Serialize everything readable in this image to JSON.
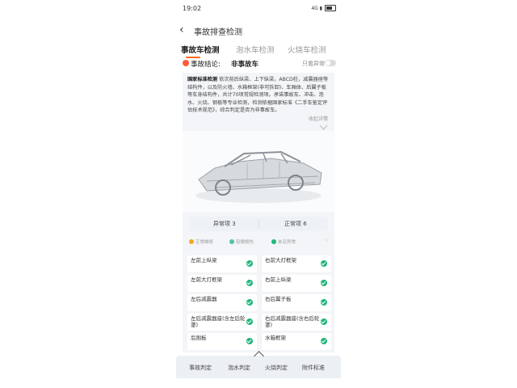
{
  "status_bar": {
    "time": "19:02",
    "right_text": "4G ▮"
  },
  "header": {
    "title": "事故排查检测",
    "back_icon": "chevron-left-icon"
  },
  "tabs": [
    {
      "label": "事故车检测",
      "active": true
    },
    {
      "label": "泡水车检测",
      "active": false
    },
    {
      "label": "火烧车检测",
      "active": false
    }
  ],
  "conclusion": {
    "label": "事故结论:",
    "value": "非事故车",
    "toggle_label": "只看异常",
    "toggle_on": false
  },
  "description": {
    "bold": "国家标准检测",
    "text": "依次前后纵梁、上下纵梁，ABCD柱，减震器座等结构件，以及防火墙、水箱框架(非可拆卸)、车厢体、后翼子板等车身结构件，共计70项常规检测项。承诺事故车、冲击、泡水、火烧、钢板等专业检测，检测依据国家标准《二手车鉴定评估技术规范》，综合判定是否为非事故车。",
    "expand_label": "收起详情"
  },
  "counts": {
    "left": "异常项 3",
    "right": "正常项 6"
  },
  "legend": [
    {
      "label": "正常维修",
      "color": "#f5a623"
    },
    {
      "label": "轻微损伤",
      "color": "#4fc3a1"
    },
    {
      "label": "未见异常",
      "color": "#1fb77a"
    }
  ],
  "items": [
    {
      "label": "左前上纵梁"
    },
    {
      "label": "右前大灯框架"
    },
    {
      "label": "左前大灯框架"
    },
    {
      "label": "右前上纵梁"
    },
    {
      "label": "左后减震器"
    },
    {
      "label": "右后翼子板"
    },
    {
      "label": "左后减震器座(含左后轮罩)"
    },
    {
      "label": "右后减震器座(含右后轮罩)"
    },
    {
      "label": "后围板"
    },
    {
      "label": "水箱框架"
    }
  ],
  "bottom_nav": [
    {
      "label": "事故判定"
    },
    {
      "label": "泡水判定"
    },
    {
      "label": "火烧判定"
    },
    {
      "label": "附件标准"
    }
  ]
}
